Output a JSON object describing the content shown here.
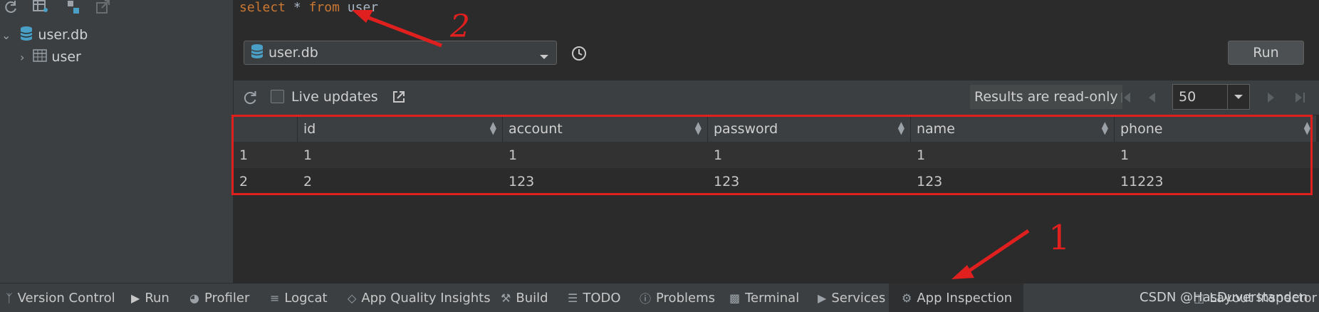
{
  "query": {
    "keyword_select": "select",
    "star": "*",
    "keyword_from": "from",
    "table": "user"
  },
  "tree": {
    "db": "user.db",
    "table": "user"
  },
  "db_selector": {
    "value": "user.db"
  },
  "run_label": "Run",
  "results": {
    "live_updates": "Live updates",
    "read_only": "Results are read-only",
    "page_size": "50"
  },
  "table": {
    "columns": [
      "",
      "id",
      "account",
      "password",
      "name",
      "phone"
    ],
    "rows": [
      [
        "1",
        "1",
        "1",
        "1",
        "1",
        "1"
      ],
      [
        "2",
        "2",
        "123",
        "123",
        "123",
        "11223"
      ]
    ]
  },
  "annotations": {
    "one": "1",
    "two": "2"
  },
  "bottom_bar": {
    "items": [
      "Version Control",
      "Run",
      "Profiler",
      "Logcat",
      "App Quality Insights",
      "Build",
      "TODO",
      "Problems",
      "Terminal",
      "Services",
      "App Inspection"
    ],
    "right": "Layout Inspector"
  },
  "watermark": "CSDN @HasDuverstanden",
  "colors": {
    "annotation_red": "#e01f1f",
    "keyword": "#cc7832",
    "db_icon": "#4a9fc6"
  }
}
